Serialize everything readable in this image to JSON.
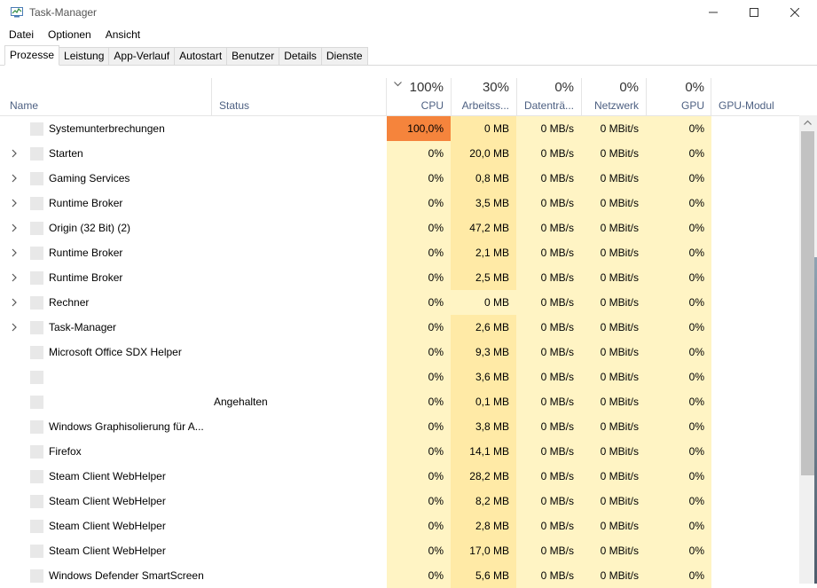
{
  "window": {
    "title": "Task-Manager"
  },
  "menu": [
    "Datei",
    "Optionen",
    "Ansicht"
  ],
  "tabs": [
    {
      "label": "Prozesse",
      "active": true
    },
    {
      "label": "Leistung",
      "active": false
    },
    {
      "label": "App-Verlauf",
      "active": false
    },
    {
      "label": "Autostart",
      "active": false
    },
    {
      "label": "Benutzer",
      "active": false
    },
    {
      "label": "Details",
      "active": false
    },
    {
      "label": "Dienste",
      "active": false
    }
  ],
  "columns": {
    "name": {
      "label": "Name"
    },
    "status": {
      "label": "Status"
    },
    "cpu": {
      "label": "CPU",
      "total": "100%"
    },
    "memory": {
      "label": "Arbeitss...",
      "total": "30%"
    },
    "disk": {
      "label": "Datenträ...",
      "total": "0%"
    },
    "network": {
      "label": "Netzwerk",
      "total": "0%"
    },
    "gpu": {
      "label": "GPU",
      "total": "0%"
    },
    "gpu_engine": {
      "label": "GPU-Modul"
    }
  },
  "processes": [
    {
      "name": "Systemunterbrechungen",
      "expandable": false,
      "status": "",
      "cpu": "100,0%",
      "memory": "0 MB",
      "disk": "0 MB/s",
      "network": "0 MBit/s",
      "gpu": "0%"
    },
    {
      "name": "Starten",
      "expandable": true,
      "status": "",
      "cpu": "0%",
      "memory": "20,0 MB",
      "disk": "0 MB/s",
      "network": "0 MBit/s",
      "gpu": "0%"
    },
    {
      "name": "Gaming Services",
      "expandable": true,
      "status": "",
      "cpu": "0%",
      "memory": "0,8 MB",
      "disk": "0 MB/s",
      "network": "0 MBit/s",
      "gpu": "0%"
    },
    {
      "name": "Runtime Broker",
      "expandable": true,
      "status": "",
      "cpu": "0%",
      "memory": "3,5 MB",
      "disk": "0 MB/s",
      "network": "0 MBit/s",
      "gpu": "0%"
    },
    {
      "name": "Origin (32 Bit) (2)",
      "expandable": true,
      "status": "",
      "cpu": "0%",
      "memory": "47,2 MB",
      "disk": "0 MB/s",
      "network": "0 MBit/s",
      "gpu": "0%"
    },
    {
      "name": "Runtime Broker",
      "expandable": true,
      "status": "",
      "cpu": "0%",
      "memory": "2,1 MB",
      "disk": "0 MB/s",
      "network": "0 MBit/s",
      "gpu": "0%"
    },
    {
      "name": "Runtime Broker",
      "expandable": true,
      "status": "",
      "cpu": "0%",
      "memory": "2,5 MB",
      "disk": "0 MB/s",
      "network": "0 MBit/s",
      "gpu": "0%"
    },
    {
      "name": "Rechner",
      "expandable": true,
      "status": "",
      "cpu": "0%",
      "memory": "0 MB",
      "disk": "0 MB/s",
      "network": "0 MBit/s",
      "gpu": "0%"
    },
    {
      "name": "Task-Manager",
      "expandable": true,
      "status": "",
      "cpu": "0%",
      "memory": "2,6 MB",
      "disk": "0 MB/s",
      "network": "0 MBit/s",
      "gpu": "0%"
    },
    {
      "name": "Microsoft Office SDX Helper",
      "expandable": false,
      "status": "",
      "cpu": "0%",
      "memory": "9,3 MB",
      "disk": "0 MB/s",
      "network": "0 MBit/s",
      "gpu": "0%"
    },
    {
      "name": "",
      "expandable": false,
      "status": "",
      "cpu": "0%",
      "memory": "3,6 MB",
      "disk": "0 MB/s",
      "network": "0 MBit/s",
      "gpu": "0%"
    },
    {
      "name": "",
      "expandable": false,
      "status": "Angehalten",
      "cpu": "0%",
      "memory": "0,1 MB",
      "disk": "0 MB/s",
      "network": "0 MBit/s",
      "gpu": "0%"
    },
    {
      "name": "Windows Graphisolierung für A...",
      "expandable": false,
      "status": "",
      "cpu": "0%",
      "memory": "3,8 MB",
      "disk": "0 MB/s",
      "network": "0 MBit/s",
      "gpu": "0%"
    },
    {
      "name": "Firefox",
      "expandable": false,
      "status": "",
      "cpu": "0%",
      "memory": "14,1 MB",
      "disk": "0 MB/s",
      "network": "0 MBit/s",
      "gpu": "0%"
    },
    {
      "name": "Steam Client WebHelper",
      "expandable": false,
      "status": "",
      "cpu": "0%",
      "memory": "28,2 MB",
      "disk": "0 MB/s",
      "network": "0 MBit/s",
      "gpu": "0%"
    },
    {
      "name": "Steam Client WebHelper",
      "expandable": false,
      "status": "",
      "cpu": "0%",
      "memory": "8,2 MB",
      "disk": "0 MB/s",
      "network": "0 MBit/s",
      "gpu": "0%"
    },
    {
      "name": "Steam Client WebHelper",
      "expandable": false,
      "status": "",
      "cpu": "0%",
      "memory": "2,8 MB",
      "disk": "0 MB/s",
      "network": "0 MBit/s",
      "gpu": "0%"
    },
    {
      "name": "Steam Client WebHelper",
      "expandable": false,
      "status": "",
      "cpu": "0%",
      "memory": "17,0 MB",
      "disk": "0 MB/s",
      "network": "0 MBit/s",
      "gpu": "0%"
    },
    {
      "name": "Windows Defender SmartScreen",
      "expandable": false,
      "status": "",
      "cpu": "0%",
      "memory": "5,6 MB",
      "disk": "0 MB/s",
      "network": "0 MBit/s",
      "gpu": "0%"
    }
  ],
  "colors": {
    "heat_low": "#fff4c4",
    "heat_mid": "#ffeaa6",
    "heat_high": "#f5843c",
    "header_label": "#4d6082"
  }
}
